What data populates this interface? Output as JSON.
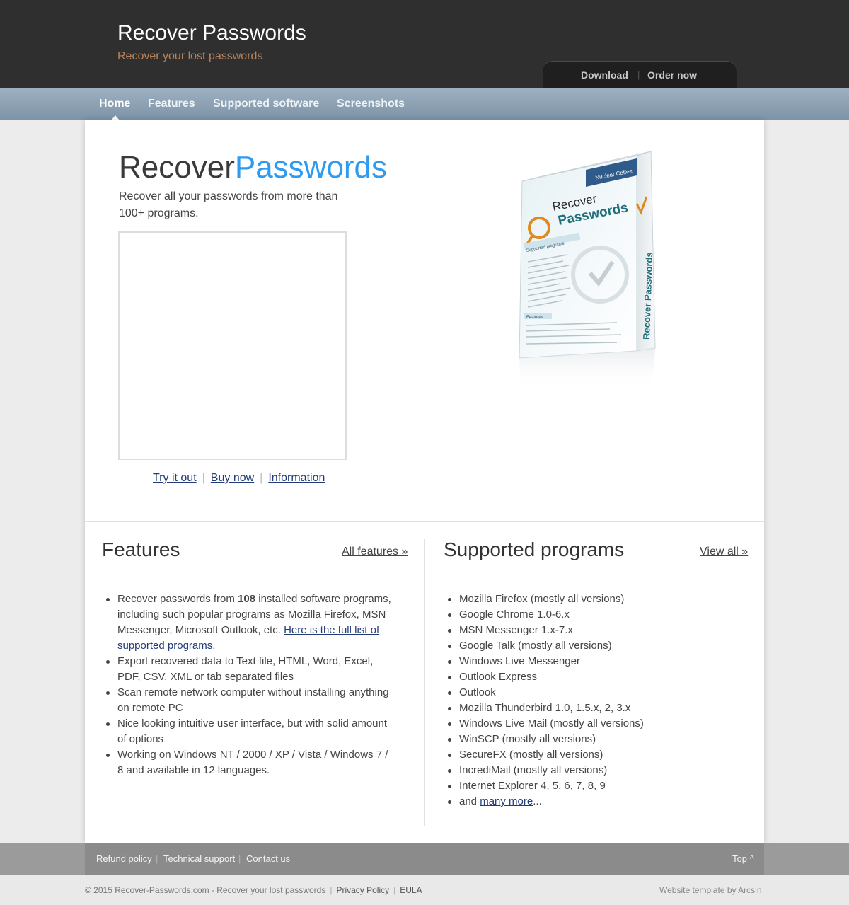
{
  "header": {
    "site_title": "Recover Passwords",
    "tagline": "Recover your lost passwords",
    "download_label": "Download",
    "order_label": "Order now"
  },
  "nav": {
    "home": "Home",
    "features": "Features",
    "supported": "Supported software",
    "screenshots": "Screenshots"
  },
  "hero": {
    "title_part1": "Recover",
    "title_part2": "Passwords",
    "subtitle": "Recover all your passwords from more than 100+ programs.",
    "try_label": "Try it out",
    "buy_label": "Buy now",
    "info_label": "Information"
  },
  "product_box": {
    "brand": "Nuclear Coffee",
    "title_line1": "Recover",
    "title_line2": "Passwords",
    "side_text": "Recover Passwords",
    "supported_heading": "Supported programs",
    "features_heading": "Features"
  },
  "features": {
    "heading": "Features",
    "more_label": "All features »",
    "item1_pre": "Recover passwords from ",
    "item1_bold": "108",
    "item1_mid": " installed software programs, including such popular programs as Mozilla Firefox, MSN Messenger, Microsoft Outlook, etc. ",
    "item1_link": "Here is the full list of supported programs",
    "item1_post": ".",
    "items": [
      "Export recovered data to Text file, HTML, Word, Excel, PDF, CSV, XML or tab separated files",
      "Scan remote network computer without installing anything on remote PC",
      "Nice looking intuitive user interface, but with solid amount of options",
      "Working on Windows NT / 2000 / XP / Vista / Windows 7 / 8 and available in 12 languages."
    ]
  },
  "supported": {
    "heading": "Supported programs",
    "more_label": "View all »",
    "items": [
      "Mozilla Firefox (mostly all versions)",
      "Google Chrome 1.0-6.x",
      "MSN Messenger 1.x-7.x",
      "Google Talk (mostly all versions)",
      "Windows Live Messenger",
      "Outlook Express",
      "Outlook",
      "Mozilla Thunderbird 1.0, 1.5.x, 2, 3.x",
      "Windows Live Mail (mostly all versions)",
      "WinSCP (mostly all versions)",
      "SecureFX (mostly all versions)",
      "IncrediMail (mostly all versions)",
      "Internet Explorer 4, 5, 6, 7, 8, 9"
    ],
    "last_pre": "and ",
    "last_link": "many more",
    "last_post": "..."
  },
  "footer": {
    "refund": "Refund policy",
    "support": "Technical support",
    "contact": "Contact us",
    "top": "Top ^",
    "copyright": "© 2015 Recover-Passwords.com - Recover your lost passwords",
    "privacy": "Privacy Policy",
    "eula": "EULA",
    "credit": "Website template by Arcsin"
  }
}
